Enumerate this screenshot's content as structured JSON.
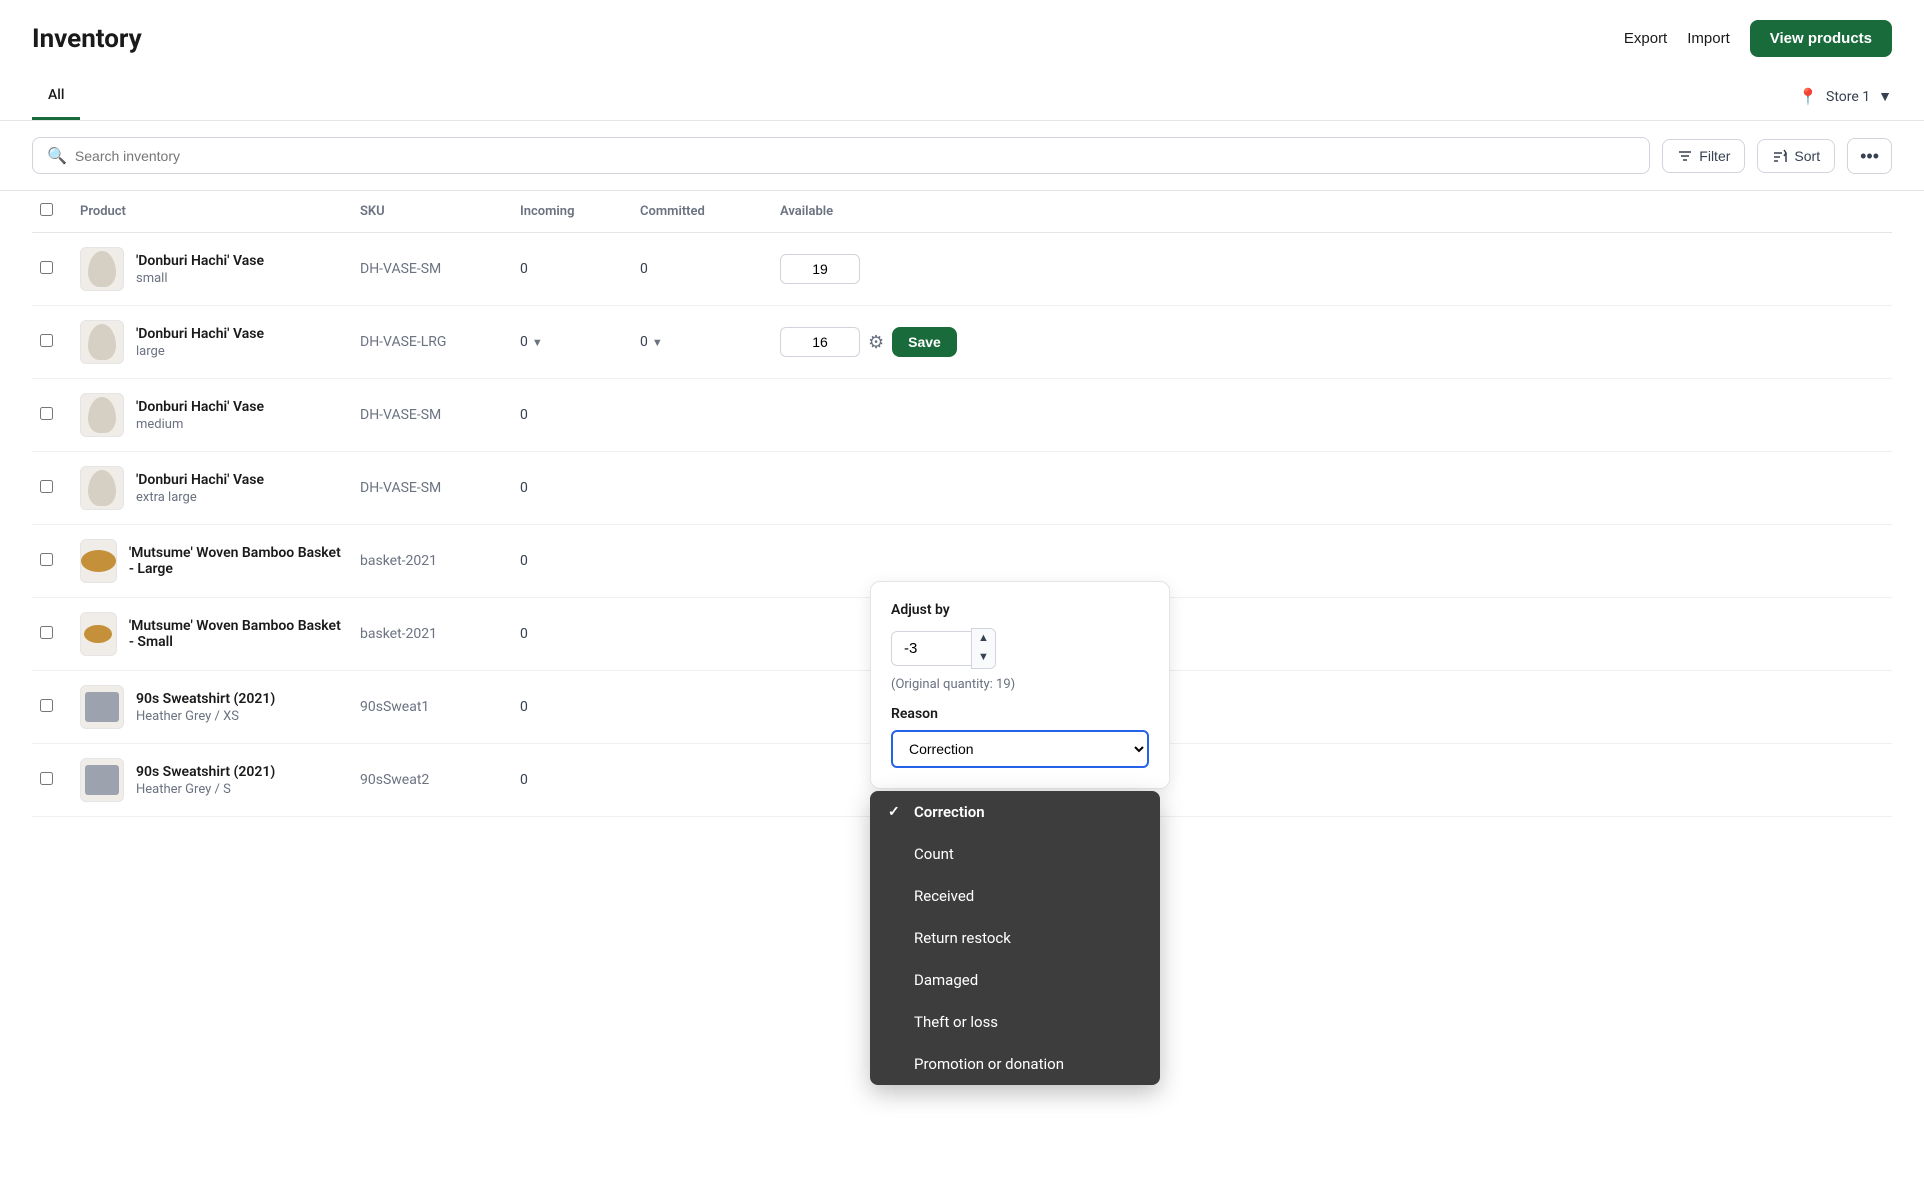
{
  "header": {
    "title": "Inventory",
    "export_label": "Export",
    "import_label": "Import",
    "view_products_label": "View products"
  },
  "tabs": {
    "items": [
      {
        "id": "all",
        "label": "All",
        "active": true
      }
    ],
    "store_label": "Store 1"
  },
  "toolbar": {
    "search_placeholder": "Search inventory",
    "filter_label": "Filter",
    "sort_label": "Sort"
  },
  "table": {
    "columns": [
      "Product",
      "SKU",
      "Incoming",
      "Committed",
      "Available"
    ],
    "rows": [
      {
        "id": 1,
        "name": "'Donburi Hachi' Vase",
        "variant": "small",
        "sku": "DH-VASE-SM",
        "incoming": "0",
        "committed": "0",
        "available": "19",
        "thumb_type": "vase"
      },
      {
        "id": 2,
        "name": "'Donburi Hachi' Vase",
        "variant": "large",
        "sku": "DH-VASE-LRG",
        "incoming": "0",
        "committed": "0",
        "available": "16",
        "thumb_type": "vase",
        "editing": true
      },
      {
        "id": 3,
        "name": "'Donburi Hachi' Vase",
        "variant": "medium",
        "sku": "DH-VASE-SM",
        "incoming": "0",
        "committed": "",
        "available": "",
        "thumb_type": "vase"
      },
      {
        "id": 4,
        "name": "'Donburi Hachi' Vase",
        "variant": "extra large",
        "sku": "DH-VASE-SM",
        "incoming": "0",
        "committed": "",
        "available": "",
        "thumb_type": "vase"
      },
      {
        "id": 5,
        "name": "'Mutsume' Woven Bamboo Basket - Large",
        "variant": "",
        "sku": "basket-2021",
        "incoming": "0",
        "committed": "",
        "available": "",
        "thumb_type": "basket"
      },
      {
        "id": 6,
        "name": "'Mutsume' Woven Bamboo Basket - Small",
        "variant": "",
        "sku": "basket-2021",
        "incoming": "0",
        "committed": "",
        "available": "",
        "thumb_type": "basket_small"
      },
      {
        "id": 7,
        "name": "90s Sweatshirt (2021)",
        "variant": "Heather Grey / XS",
        "sku": "90sSweat1",
        "incoming": "0",
        "committed": "",
        "available": "",
        "thumb_type": "shirt"
      },
      {
        "id": 8,
        "name": "90s Sweatshirt (2021)",
        "variant": "Heather Grey / S",
        "sku": "90sSweat2",
        "incoming": "0",
        "committed": "",
        "available": "",
        "thumb_type": "shirt"
      }
    ]
  },
  "adjust_panel": {
    "adjust_by_label": "Adjust by",
    "adjust_value": "-3",
    "original_qty_text": "(Original quantity: 19)",
    "reason_label": "Reason",
    "reason_selected": "Correction"
  },
  "reason_dropdown": {
    "items": [
      {
        "id": "correction",
        "label": "Correction",
        "selected": true
      },
      {
        "id": "count",
        "label": "Count",
        "selected": false
      },
      {
        "id": "received",
        "label": "Received",
        "selected": false
      },
      {
        "id": "return_restock",
        "label": "Return restock",
        "selected": false
      },
      {
        "id": "damaged",
        "label": "Damaged",
        "selected": false
      },
      {
        "id": "theft_or_loss",
        "label": "Theft or loss",
        "selected": false
      },
      {
        "id": "promotion_or_donation",
        "label": "Promotion or donation",
        "selected": false
      }
    ]
  },
  "save_label": "Save"
}
